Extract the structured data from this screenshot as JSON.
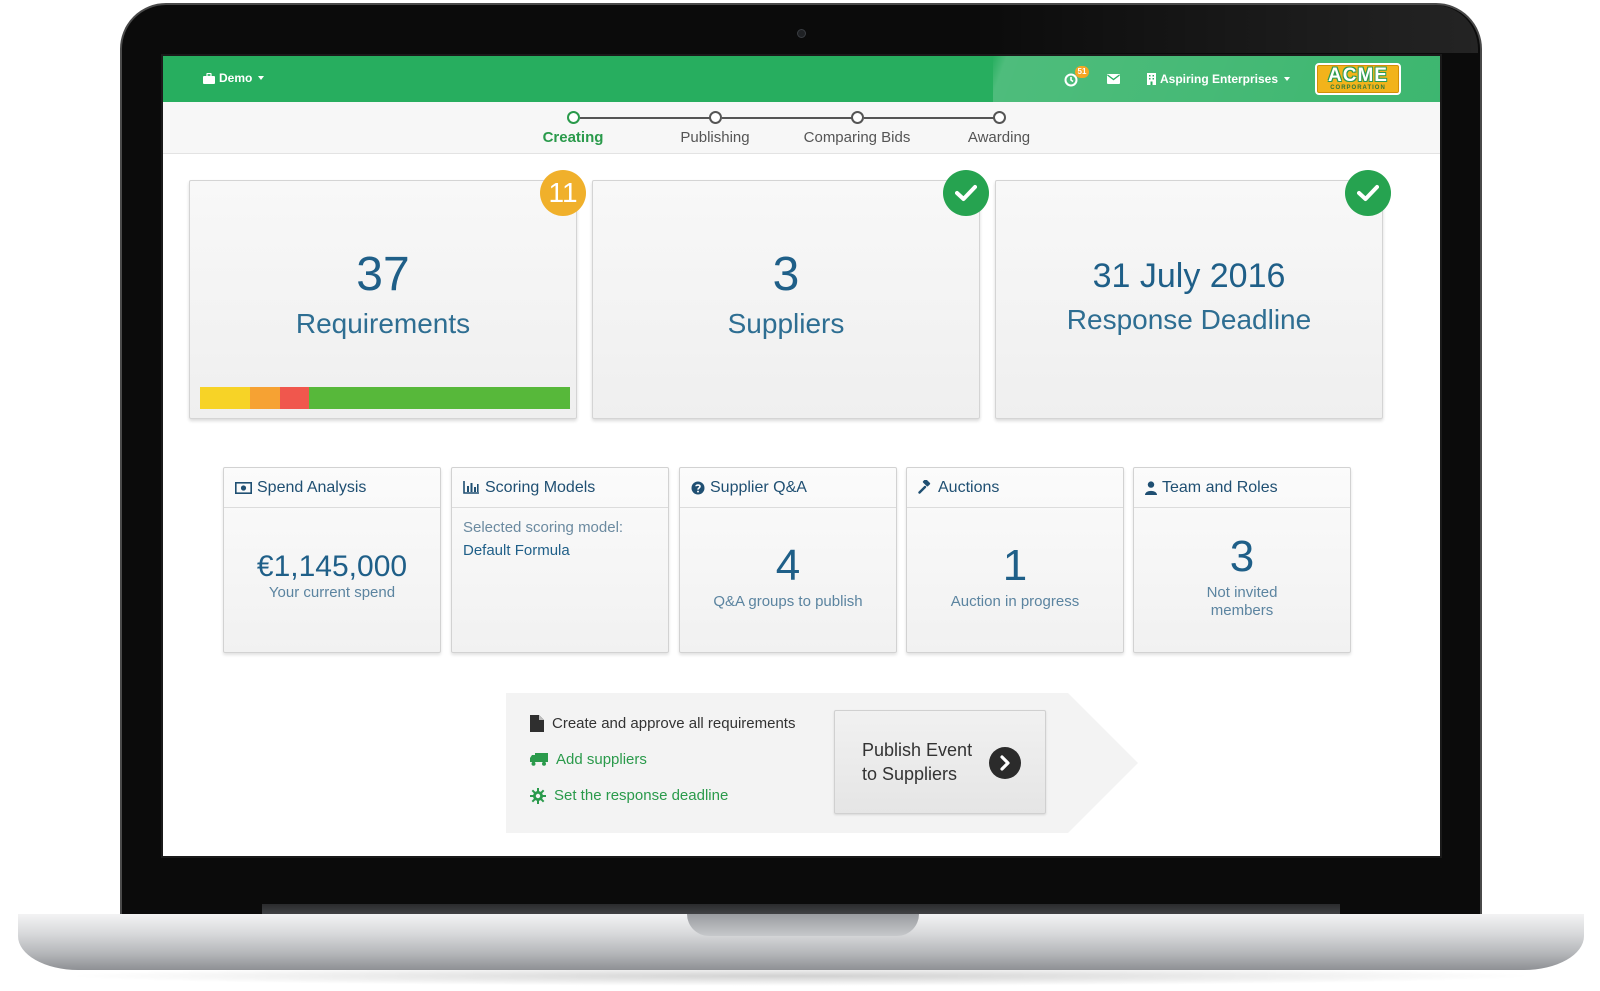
{
  "topbar": {
    "workspace_label": "Demo",
    "notification_count": "51",
    "company_label": "Aspiring Enterprises",
    "logo_text": "ACME",
    "logo_subtext": "CORPORATION",
    "accent_color": "#27ae5f"
  },
  "stepper": {
    "steps": [
      {
        "label": "Creating",
        "active": true
      },
      {
        "label": "Publishing",
        "active": false
      },
      {
        "label": "Comparing Bids",
        "active": false
      },
      {
        "label": "Awarding",
        "active": false
      }
    ]
  },
  "summary": {
    "requirements": {
      "count": "37",
      "label": "Requirements",
      "badge": "11",
      "progress": [
        {
          "status": "yellow",
          "fraction": 0.135,
          "color": "#f7d326"
        },
        {
          "status": "orange",
          "fraction": 0.08,
          "color": "#f6a233"
        },
        {
          "status": "red",
          "fraction": 0.08,
          "color": "#f0574d"
        },
        {
          "status": "green",
          "fraction": 0.705,
          "color": "#57b83a"
        }
      ]
    },
    "suppliers": {
      "count": "3",
      "label": "Suppliers",
      "status": "complete"
    },
    "deadline": {
      "date": "31 July 2016",
      "label": "Response Deadline",
      "status": "complete"
    }
  },
  "modules": {
    "spend": {
      "title": "Spend Analysis",
      "value": "€1,145,000",
      "sub": "Your current spend"
    },
    "scoring": {
      "title": "Scoring Models",
      "caption": "Selected scoring model:",
      "value": "Default Formula"
    },
    "qa": {
      "title": "Supplier Q&A",
      "value": "4",
      "sub": "Q&A groups to publish"
    },
    "auctions": {
      "title": "Auctions",
      "value": "1",
      "sub": "Auction in progress"
    },
    "team": {
      "title": "Team and Roles",
      "value": "3",
      "sub_line1": "Not invited",
      "sub_line2": "members"
    }
  },
  "checklist": {
    "items": [
      {
        "label": "Create and approve all requirements",
        "icon": "document-icon",
        "is_link": false
      },
      {
        "label": "Add suppliers",
        "icon": "truck-icon",
        "is_link": true
      },
      {
        "label": "Set the response deadline",
        "icon": "gear-icon",
        "is_link": true
      }
    ],
    "publish_line1": "Publish Event",
    "publish_line2": "to Suppliers"
  }
}
